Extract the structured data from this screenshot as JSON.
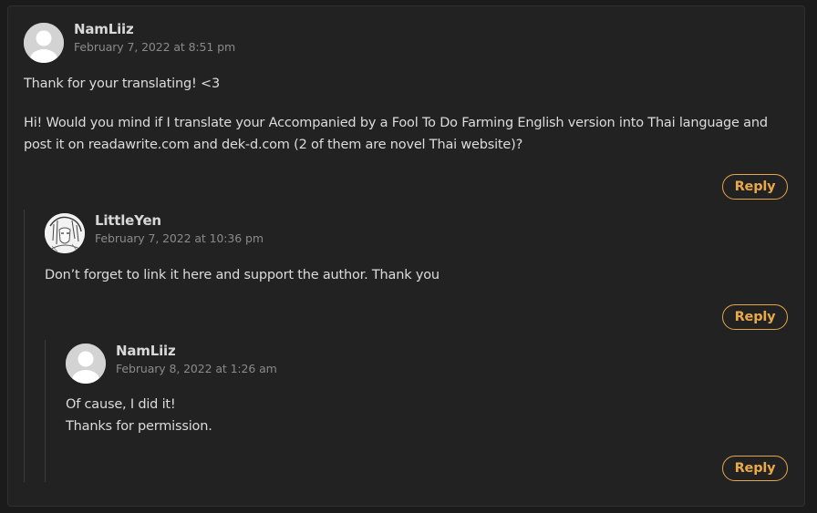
{
  "comments": [
    {
      "author": "NamLiiz",
      "date": "February 7, 2022 at 8:51 pm",
      "paragraphs": [
        "Thank for your translating! <3",
        "Hi! Would you mind if I translate your Accompanied by a Fool To Do Farming English version into Thai language and post it on readawrite.com and dek-d.com (2 of them are novel Thai website)?"
      ],
      "reply_label": "Reply",
      "avatar": "default-avatar"
    },
    {
      "author": "LittleYen",
      "date": "February 7, 2022 at 10:36 pm",
      "paragraphs": [
        "Don’t forget to link it here and support the author. Thank you"
      ],
      "reply_label": "Reply",
      "avatar": "sketch-avatar"
    },
    {
      "author": "NamLiiz",
      "date": "February 8, 2022 at 1:26 am",
      "lines": [
        "Of cause, I did it!",
        "Thanks for permission."
      ],
      "reply_label": "Reply",
      "avatar": "default-avatar"
    }
  ],
  "colors": {
    "background": "#1b1b1b",
    "panel": "#222222",
    "accent": "#e9a84a",
    "text": "#dcdcdc",
    "muted": "#8a8a8a"
  }
}
